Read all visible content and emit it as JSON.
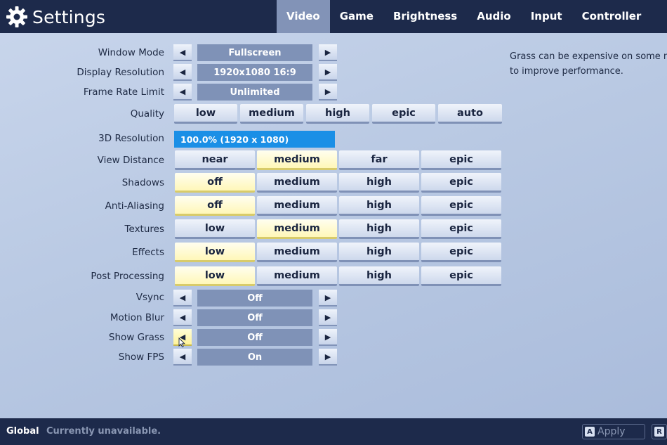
{
  "header": {
    "title": "Settings",
    "tabs": [
      "Video",
      "Game",
      "Brightness",
      "Audio",
      "Input",
      "Controller"
    ],
    "active_tab": "Video"
  },
  "help_text": {
    "line1": "Grass can be expensive on some mach",
    "line2": "to improve performance."
  },
  "settings": {
    "window_mode": {
      "label": "Window Mode",
      "value": "Fullscreen"
    },
    "display_resolution": {
      "label": "Display Resolution",
      "value": "1920x1080 16:9"
    },
    "frame_rate_limit": {
      "label": "Frame Rate Limit",
      "value": "Unlimited"
    },
    "quality": {
      "label": "Quality",
      "options": [
        "low",
        "medium",
        "high",
        "epic",
        "auto"
      ]
    },
    "resolution_3d": {
      "label": "3D Resolution",
      "value": "100.0%  (1920 x 1080)"
    },
    "view_distance": {
      "label": "View Distance",
      "options": [
        "near",
        "medium",
        "far",
        "epic"
      ],
      "selected": "medium"
    },
    "shadows": {
      "label": "Shadows",
      "options": [
        "off",
        "medium",
        "high",
        "epic"
      ],
      "selected": "off"
    },
    "anti_aliasing": {
      "label": "Anti-Aliasing",
      "options": [
        "off",
        "medium",
        "high",
        "epic"
      ],
      "selected": "off"
    },
    "textures": {
      "label": "Textures",
      "options": [
        "low",
        "medium",
        "high",
        "epic"
      ],
      "selected": "medium"
    },
    "effects": {
      "label": "Effects",
      "options": [
        "low",
        "medium",
        "high",
        "epic"
      ],
      "selected": "low"
    },
    "post_processing": {
      "label": "Post Processing",
      "options": [
        "low",
        "medium",
        "high",
        "epic"
      ],
      "selected": "low"
    },
    "vsync": {
      "label": "Vsync",
      "value": "Off"
    },
    "motion_blur": {
      "label": "Motion Blur",
      "value": "Off"
    },
    "show_grass": {
      "label": "Show Grass",
      "value": "Off"
    },
    "show_fps": {
      "label": "Show FPS",
      "value": "On"
    }
  },
  "footer": {
    "scope": "Global",
    "status": "Currently unavailable.",
    "apply_key": "A",
    "apply_label": "Apply",
    "reset_key": "R"
  },
  "colors": {
    "bar_bg": "#1d2a4b",
    "active_tab": "#8293b7",
    "value_box": "#7f92b7",
    "selected_option": "#fff7b8",
    "resolution_bar": "#1a8fe6"
  },
  "icons": {
    "title": "gear-icon",
    "arrow_left": "arrow-left-icon",
    "arrow_right": "arrow-right-icon"
  }
}
